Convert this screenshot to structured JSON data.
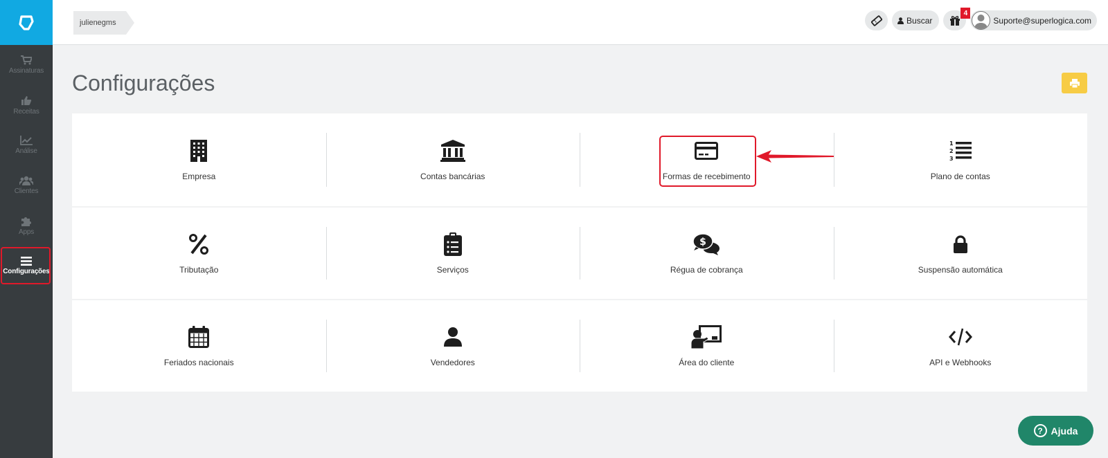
{
  "sidebar": {
    "items": [
      {
        "label": "Assinaturas",
        "icon": "cart-icon"
      },
      {
        "label": "Receitas",
        "icon": "thumbs-up-icon"
      },
      {
        "label": "Análise",
        "icon": "chart-line-icon"
      },
      {
        "label": "Clientes",
        "icon": "users-icon"
      },
      {
        "label": "Apps",
        "icon": "puzzle-icon"
      },
      {
        "label": "Configurações",
        "icon": "menu-icon",
        "active": true
      }
    ]
  },
  "header": {
    "breadcrumb": "julienegms",
    "buscar_label": "Buscar",
    "gift_badge": "4",
    "user_email": "Suporte@superlogica.com"
  },
  "main": {
    "title": "Configurações",
    "tiles": [
      {
        "label": "Empresa",
        "icon": "building-icon"
      },
      {
        "label": "Contas bancárias",
        "icon": "bank-icon"
      },
      {
        "label": "Formas de recebimento",
        "icon": "credit-card-icon"
      },
      {
        "label": "Plano de contas",
        "icon": "numbered-list-icon"
      },
      {
        "label": "Tributação",
        "icon": "percent-icon"
      },
      {
        "label": "Serviços",
        "icon": "clipboard-list-icon"
      },
      {
        "label": "Régua de cobrança",
        "icon": "chat-dollar-icon"
      },
      {
        "label": "Suspensão automática",
        "icon": "lock-icon"
      },
      {
        "label": "Feriados nacionais",
        "icon": "calendar-icon"
      },
      {
        "label": "Vendedores",
        "icon": "user-icon"
      },
      {
        "label": "Área do cliente",
        "icon": "presentation-icon"
      },
      {
        "label": "API e Webhooks",
        "icon": "code-icon"
      }
    ]
  },
  "help": {
    "label": "Ajuda"
  },
  "colors": {
    "brand": "#11a9e2",
    "sidebar_bg": "#373c3f",
    "highlight": "#e0192a",
    "print_button": "#f7cc45",
    "help_button": "#208669"
  }
}
